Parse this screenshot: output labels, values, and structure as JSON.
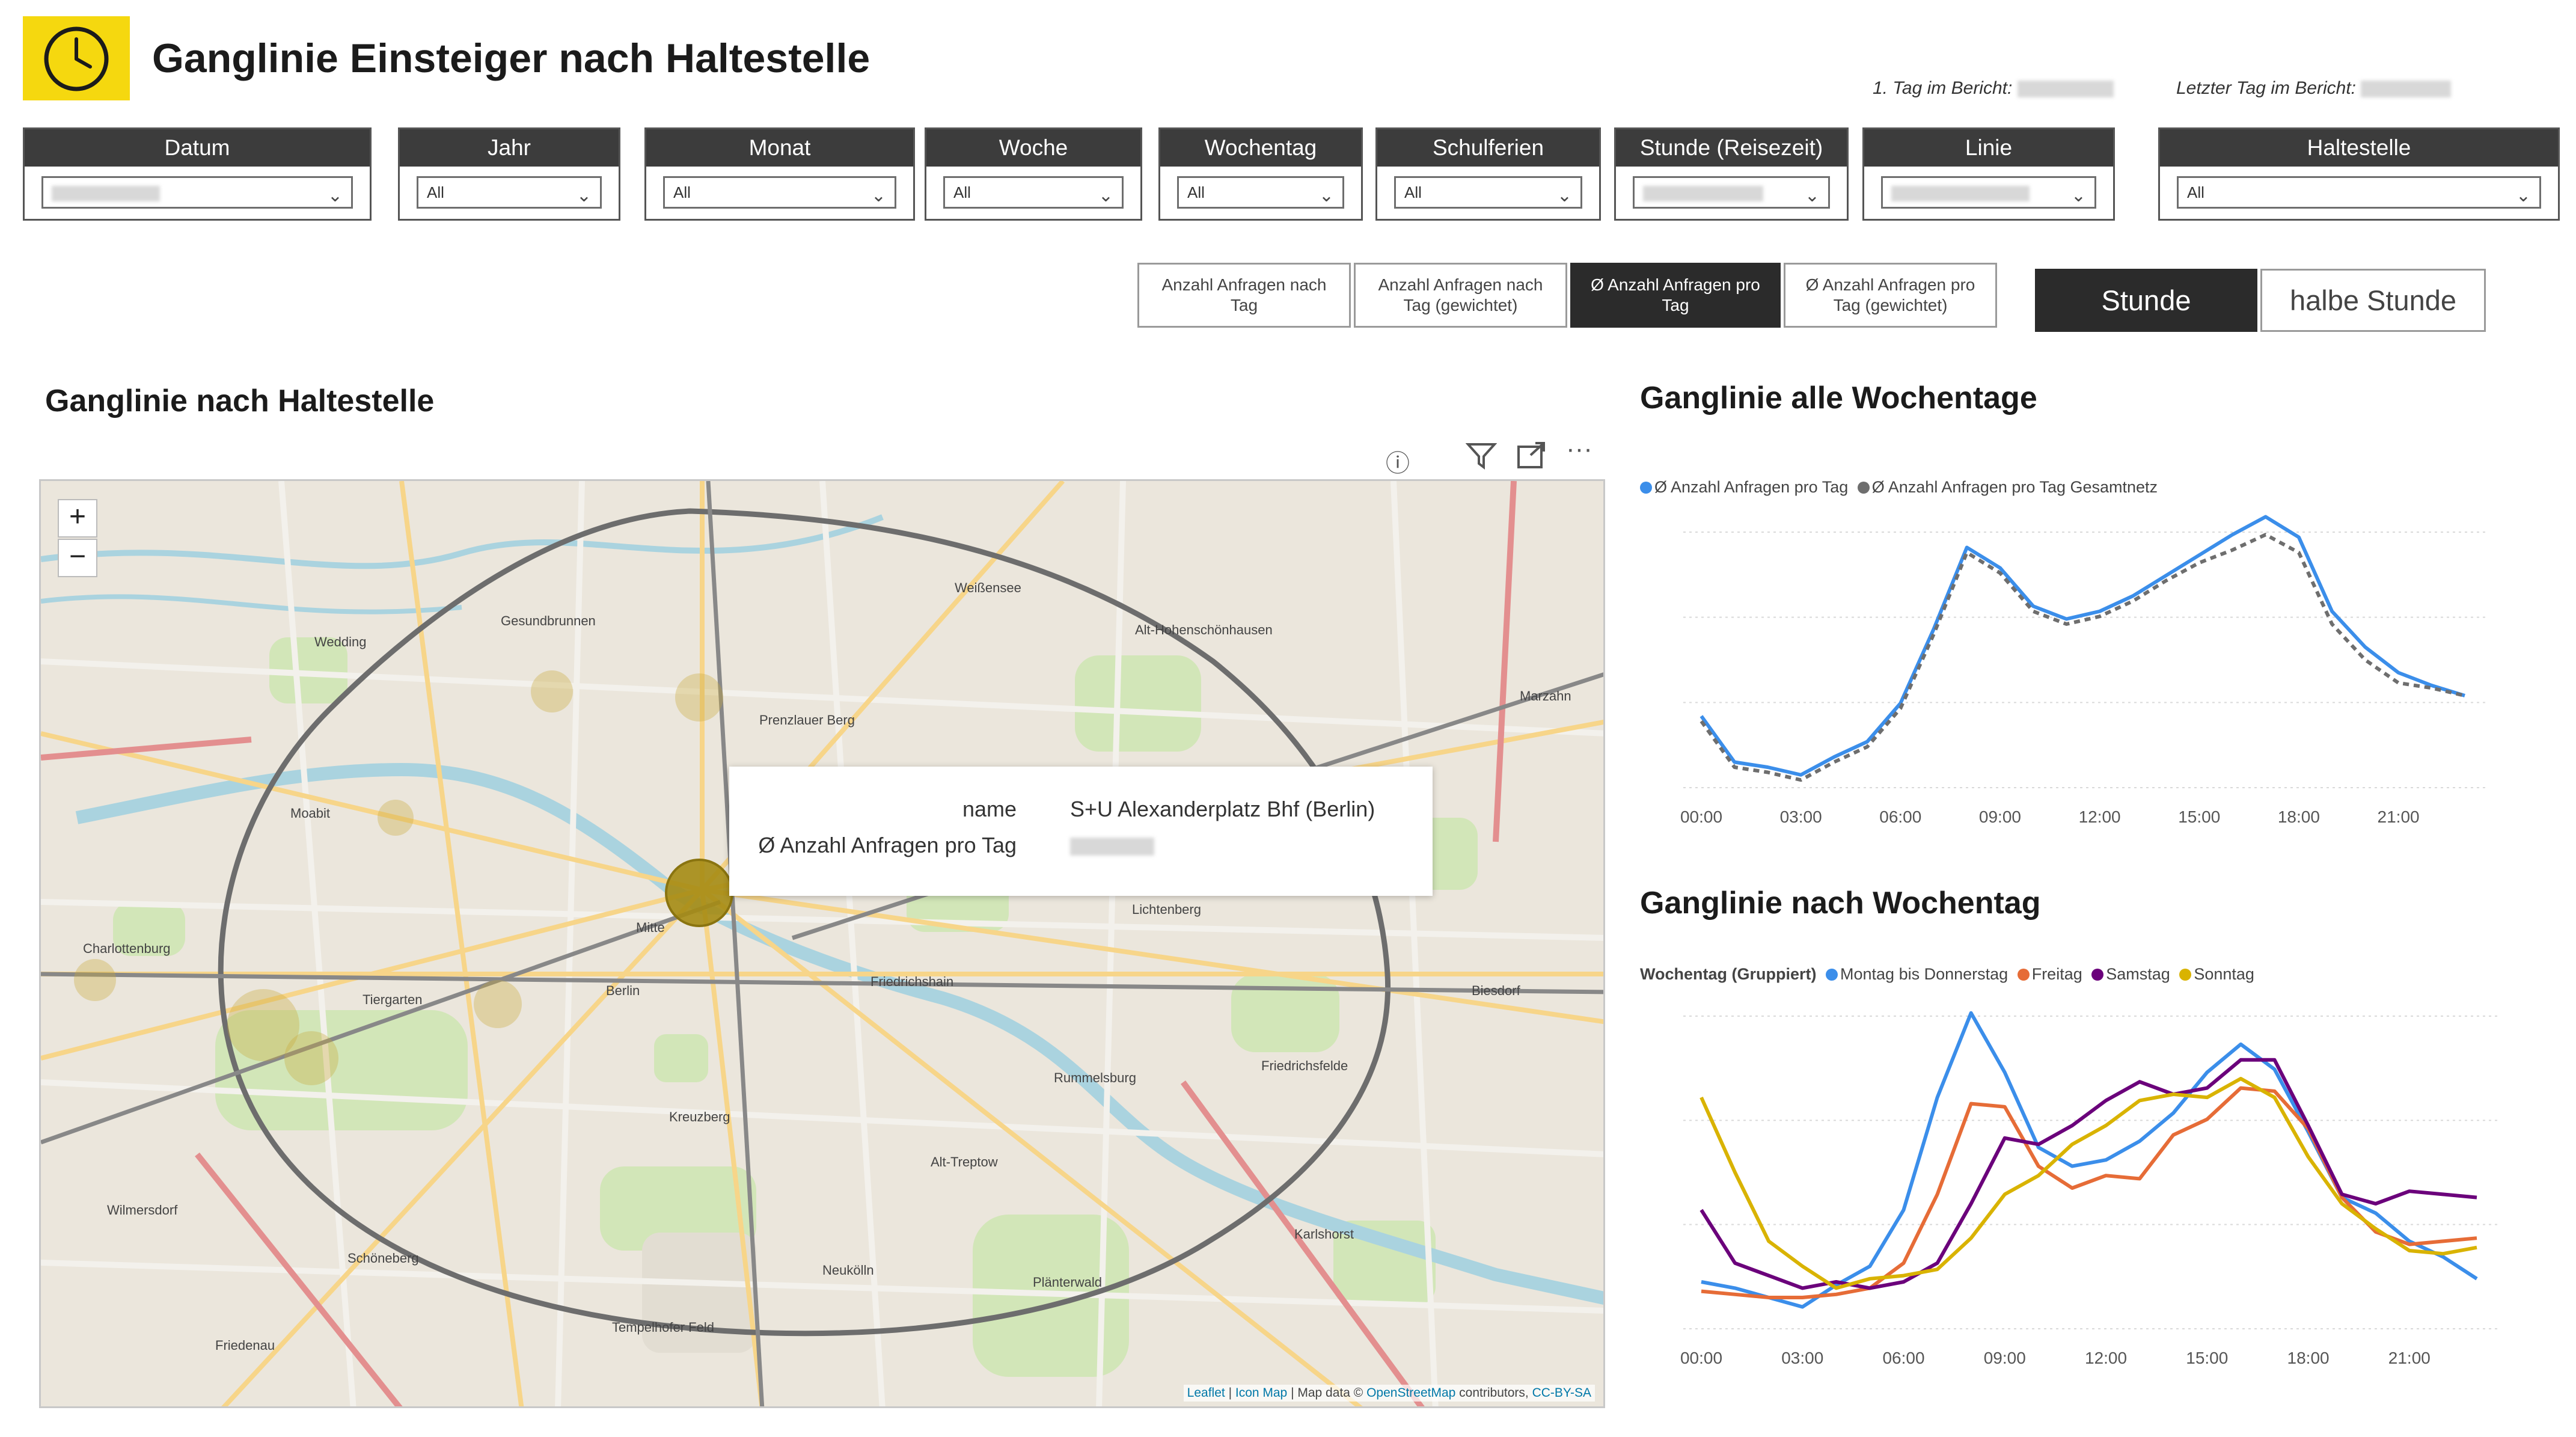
{
  "header": {
    "title": "Ganglinie Einsteiger nach Haltestelle",
    "first_day_label": "1. Tag im Bericht:",
    "last_day_label": "Letzter Tag im Bericht:"
  },
  "slicers": [
    {
      "label": "Datum",
      "value": ""
    },
    {
      "label": "Jahr",
      "value": "All"
    },
    {
      "label": "Monat",
      "value": "All"
    },
    {
      "label": "Woche",
      "value": "All"
    },
    {
      "label": "Wochentag",
      "value": "All"
    },
    {
      "label": "Schulferien",
      "value": "All"
    },
    {
      "label": "Stunde (Reisezeit)",
      "value": ""
    },
    {
      "label": "Linie",
      "value": ""
    },
    {
      "label": "Haltestelle",
      "value": "All"
    }
  ],
  "measure_buttons": [
    {
      "l1": "Anzahl Anfragen nach",
      "l2": "Tag"
    },
    {
      "l1": "Anzahl Anfragen nach",
      "l2": "Tag (gewichtet)"
    },
    {
      "l1": "Ø Anzahl Anfragen pro",
      "l2": "Tag"
    },
    {
      "l1": "Ø Anzahl Anfragen pro",
      "l2": "Tag (gewichtet)"
    }
  ],
  "time_buttons": {
    "hour": "Stunde",
    "half_hour": "halbe Stunde"
  },
  "map": {
    "title": "Ganglinie nach Haltestelle",
    "zoom_in": "+",
    "zoom_out": "−",
    "tooltip": {
      "name_label": "name",
      "name_value": "S+U Alexanderplatz Bhf (Berlin)",
      "measure_label": "Ø Anzahl Anfragen pro Tag"
    },
    "attribution": {
      "leaflet": "Leaflet",
      "sep1": " | ",
      "icon_map": "Icon Map",
      "mid": " | Map data © ",
      "osm": "OpenStreetMap",
      "mid2": " contributors, ",
      "license": "CC-BY-SA"
    },
    "places": [
      {
        "name": "Wedding"
      },
      {
        "name": "Gesundbrunnen"
      },
      {
        "name": "Weißensee"
      },
      {
        "name": "Alt-Hohenschönhausen"
      },
      {
        "name": "Prenzlauer Berg"
      },
      {
        "name": "Marzahn"
      },
      {
        "name": "Moabit"
      },
      {
        "name": "Mitte"
      },
      {
        "name": "Berlin"
      },
      {
        "name": "Lichtenberg"
      },
      {
        "name": "Friedrichshain"
      },
      {
        "name": "Charlottenburg"
      },
      {
        "name": "Tiergarten"
      },
      {
        "name": "Biesdorf"
      },
      {
        "name": "Rummelsburg"
      },
      {
        "name": "Friedrichsfelde"
      },
      {
        "name": "Kreuzberg"
      },
      {
        "name": "Alt-Treptow"
      },
      {
        "name": "Karlshorst"
      },
      {
        "name": "Wilmersdorf"
      },
      {
        "name": "Schöneberg"
      },
      {
        "name": "Neukölln"
      },
      {
        "name": "Plänterwald"
      },
      {
        "name": "Tempelhofer Feld"
      },
      {
        "name": "Friedenau"
      }
    ]
  },
  "colors": {
    "accent_yellow": "#F5D80F",
    "dark": "#2B2B2B",
    "blue": "#3B8EEA",
    "gray": "#6E6E6E",
    "orange": "#E66C37",
    "purple": "#6B007B",
    "gold": "#D9B300"
  },
  "chart_data": [
    {
      "type": "line",
      "title": "Ganglinie alle Wochentage",
      "legend_position": "top-left",
      "grid": true,
      "x": [
        "00:00",
        "01:00",
        "02:00",
        "03:00",
        "04:00",
        "05:00",
        "06:00",
        "07:00",
        "08:00",
        "09:00",
        "10:00",
        "11:00",
        "12:00",
        "13:00",
        "14:00",
        "15:00",
        "16:00",
        "17:00",
        "18:00",
        "19:00",
        "20:00",
        "21:00",
        "22:00",
        "23:00"
      ],
      "x_ticks": [
        "00:00",
        "03:00",
        "06:00",
        "09:00",
        "12:00",
        "15:00",
        "18:00",
        "21:00"
      ],
      "ylim": [
        0,
        1
      ],
      "series": [
        {
          "name": "Ø Anzahl Anfragen pro Tag",
          "color": "#3B8EEA",
          "style": "solid",
          "values": [
            0.28,
            0.1,
            0.08,
            0.05,
            0.12,
            0.18,
            0.33,
            0.62,
            0.94,
            0.86,
            0.71,
            0.66,
            0.69,
            0.75,
            0.83,
            0.91,
            0.99,
            1.06,
            0.98,
            0.69,
            0.55,
            0.45,
            0.4,
            0.36
          ]
        },
        {
          "name": "Ø Anzahl Anfragen pro Tag Gesamtnetz",
          "color": "#6E6E6E",
          "style": "dashed",
          "values": [
            0.26,
            0.08,
            0.06,
            0.03,
            0.1,
            0.16,
            0.31,
            0.6,
            0.92,
            0.84,
            0.69,
            0.64,
            0.67,
            0.73,
            0.81,
            0.88,
            0.93,
            0.99,
            0.92,
            0.64,
            0.5,
            0.41,
            0.39,
            0.36
          ]
        }
      ]
    },
    {
      "type": "line",
      "title": "Ganglinie nach Wochentag",
      "legend_title": "Wochentag (Gruppiert)",
      "legend_position": "top-left",
      "grid": true,
      "x": [
        "00:00",
        "01:00",
        "02:00",
        "03:00",
        "04:00",
        "05:00",
        "06:00",
        "07:00",
        "08:00",
        "09:00",
        "10:00",
        "11:00",
        "12:00",
        "13:00",
        "14:00",
        "15:00",
        "16:00",
        "17:00",
        "18:00",
        "19:00",
        "20:00",
        "21:00",
        "22:00",
        "23:00"
      ],
      "x_ticks": [
        "00:00",
        "03:00",
        "06:00",
        "09:00",
        "12:00",
        "15:00",
        "18:00",
        "21:00"
      ],
      "ylim": [
        0,
        1
      ],
      "series": [
        {
          "name": "Montag bis Donnerstag",
          "color": "#3B8EEA",
          "values": [
            0.15,
            0.13,
            0.1,
            0.07,
            0.14,
            0.2,
            0.38,
            0.74,
            1.01,
            0.82,
            0.58,
            0.52,
            0.54,
            0.6,
            0.69,
            0.82,
            0.91,
            0.83,
            0.63,
            0.42,
            0.37,
            0.28,
            0.23,
            0.16
          ]
        },
        {
          "name": "Freitag",
          "color": "#E66C37",
          "values": [
            0.12,
            0.11,
            0.1,
            0.1,
            0.11,
            0.13,
            0.21,
            0.43,
            0.72,
            0.71,
            0.52,
            0.45,
            0.49,
            0.48,
            0.62,
            0.67,
            0.77,
            0.76,
            0.64,
            0.42,
            0.31,
            0.27,
            0.28,
            0.29
          ]
        },
        {
          "name": "Samstag",
          "color": "#6B007B",
          "values": [
            0.38,
            0.21,
            0.17,
            0.13,
            0.15,
            0.13,
            0.15,
            0.21,
            0.4,
            0.61,
            0.59,
            0.65,
            0.73,
            0.79,
            0.75,
            0.77,
            0.86,
            0.86,
            0.65,
            0.43,
            0.4,
            0.44,
            0.43,
            0.42
          ]
        },
        {
          "name": "Sonntag",
          "color": "#D9B300",
          "values": [
            0.74,
            0.5,
            0.28,
            0.2,
            0.13,
            0.16,
            0.17,
            0.19,
            0.29,
            0.43,
            0.49,
            0.59,
            0.65,
            0.73,
            0.75,
            0.74,
            0.8,
            0.74,
            0.55,
            0.4,
            0.32,
            0.25,
            0.24,
            0.26
          ]
        }
      ]
    }
  ]
}
